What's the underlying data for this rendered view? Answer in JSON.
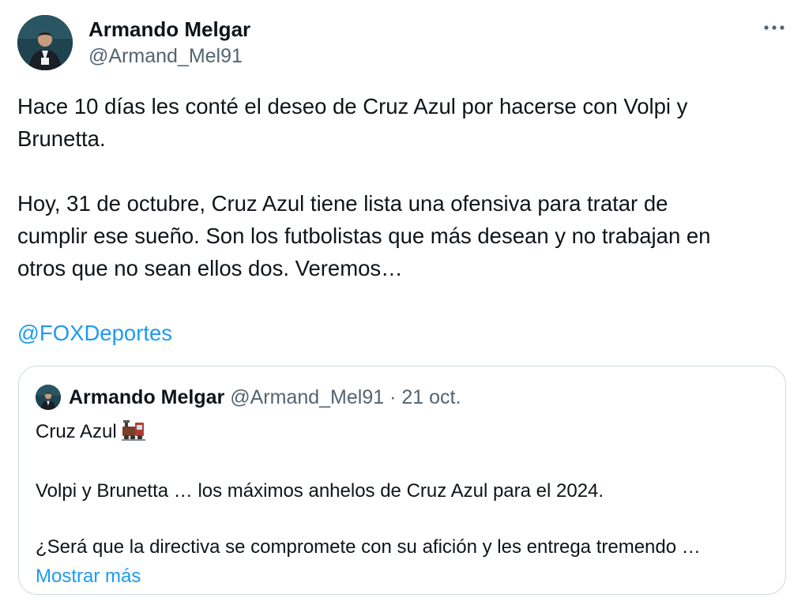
{
  "author": {
    "name": "Armando Melgar",
    "handle": "@Armand_Mel91",
    "avatar_icon": "profile-photo"
  },
  "more_icon": "more-options-icon",
  "tweet": {
    "lines": [
      "Hace 10 días les conté el deseo de Cruz Azul por hacerse con Volpi y",
      "Brunetta.",
      "",
      "Hoy, 31 de octubre, Cruz Azul tiene lista una ofensiva para tratar de",
      "cumplir ese sueño. Son los futbolistas que más desean y no trabajan en",
      "otros que no sean ellos dos. Veremos…",
      ""
    ],
    "mention": "@FOXDeportes"
  },
  "quote": {
    "name": "Armando Melgar",
    "handle": "@Armand_Mel91",
    "separator": "·",
    "date": "21 oct.",
    "line1": "Cruz Azul",
    "line1_emoji": "train-emoji",
    "line2": "Volpi y Brunetta … los máximos anhelos de Cruz Azul para el 2024.",
    "line3": "¿Será que la directiva se compromete con su afición y les entrega tremendo …",
    "show_more": "Mostrar más"
  },
  "colors": {
    "text": "#0f1419",
    "secondary": "#536471",
    "link": "#1d9bf0",
    "border": "#cfd9de"
  }
}
